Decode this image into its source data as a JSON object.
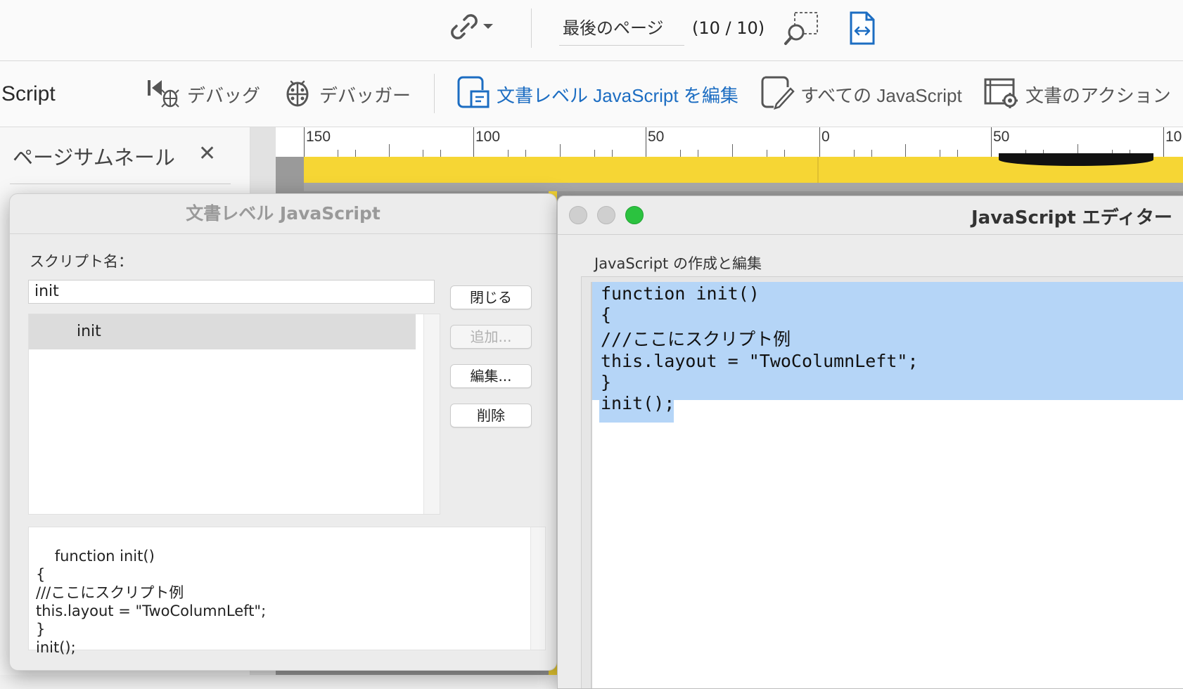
{
  "topbar": {
    "link_icon": "link-icon",
    "page_label": "最後のページ",
    "page_count": "(10 / 10)",
    "zoom_icon": "marquee-zoom-icon",
    "fit_icon": "fit-width-icon"
  },
  "toolbar": {
    "title": "Script",
    "debug": "デバッグ",
    "debugger": "デバッガー",
    "edit_doc_js": "文書レベル JavaScript を編集",
    "all_js": "すべての JavaScript",
    "doc_actions": "文書のアクション",
    "accent": "#1c6dc2"
  },
  "left_panel": {
    "title": "ページサムネール",
    "close": "✕"
  },
  "ruler": {
    "labels": [
      "150",
      "100",
      "50",
      "0",
      "50",
      "10"
    ]
  },
  "doc_js_dialog": {
    "title": "文書レベル JavaScript",
    "script_name_label": "スクリプト名：",
    "script_name_value": "init",
    "scripts": [
      "init"
    ],
    "buttons": {
      "close": "閉じる",
      "add": "追加...",
      "edit": "編集...",
      "delete": "削除"
    },
    "code_preview": "function init()\n{\n///ここにスクリプト例\nthis.layout = \"TwoColumnLeft\";\n}\ninit();"
  },
  "js_editor": {
    "title": "JavaScript エディター",
    "subtitle": "JavaScript の作成と編集",
    "lines": [
      "function init()",
      "{",
      "///ここにスクリプト例",
      "this.layout = \"TwoColumnLeft\";",
      "}",
      "init();"
    ],
    "selection_color": "#b5d5f7",
    "max_button_color": "#2bc23f"
  }
}
